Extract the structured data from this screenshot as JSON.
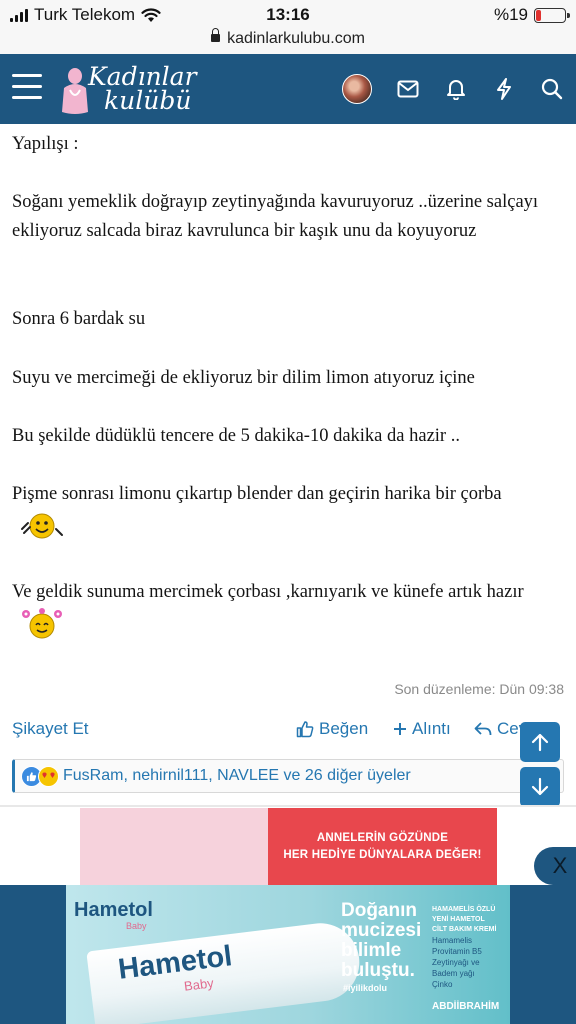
{
  "status_bar": {
    "carrier": "Turk Telekom",
    "time": "13:16",
    "battery": "%19",
    "battery_level": 0.19,
    "battery_color": "#e0322f"
  },
  "url_bar": {
    "url": "kadinlarkulubu.com"
  },
  "header": {
    "logo_line1": "Kadınlar",
    "logo_line2": "kulübü",
    "icons": [
      "menu-icon",
      "avatar",
      "mail-icon",
      "bell-icon",
      "bolt-icon",
      "search-icon"
    ],
    "background": "#1e5680"
  },
  "post": {
    "paragraphs": [
      "Yapılışı :",
      "Soğanı yemeklik doğrayıp zeytinyağında kavuruyoruz ..üzerine salçayı ekliyoruz salcada biraz kavrulunca bir kaşık unu da koyuyoruz",
      "Sonra 6 bardak su",
      "Suyu ve mercimeği de ekliyoruz bir dilim limon atıyoruz içine",
      "Bu şekilde düdüklü tencere de 5 dakika-10 dakika da hazir ..",
      "Pişme sonrası limonu çıkartıp blender dan geçirin harika bir çorba",
      "Ve geldik sunuma mercimek çorbası ,karnıyarık ve künefe artık hazır"
    ],
    "edited": "Son düzenleme: Dün 09:38"
  },
  "actions": {
    "report": "Şikayet Et",
    "like": "Beğen",
    "quote": "Alıntı",
    "reply": "Cevapla",
    "accent": "#2577b1"
  },
  "reactions": {
    "text": "FusRam, nehirnil111, NAVLEE ve 26 diğer üyeler"
  },
  "ads": {
    "top_line1": "ANNELERİN GÖZÜNDE",
    "top_line2": "HER HEDİYE DÜNYALARA DEĞER!",
    "close": "X",
    "brand": "Hametol",
    "brand_sub": "Baby",
    "tube_brand": "Hametol",
    "tube_sub": "Baby",
    "slogan_1": "Doğanın",
    "slogan_2": "mucizesi",
    "slogan_3": "bilimle",
    "slogan_4": "buluştu.",
    "hashtag": "#iyilikdolu",
    "info_1": "HAMAMELİS ÖZLÜ",
    "info_2": "YENİ HAMETOL",
    "info_3": "CİLT BAKIM KREMİ",
    "ingredients_1": "Hamamelis",
    "ingredients_2": "Provitamin B5",
    "ingredients_3": "Zeytinyağı ve",
    "ingredients_4": "Badem yağı",
    "ingredients_5": "Çinko",
    "maker": "ABDİİBRAHİM"
  }
}
